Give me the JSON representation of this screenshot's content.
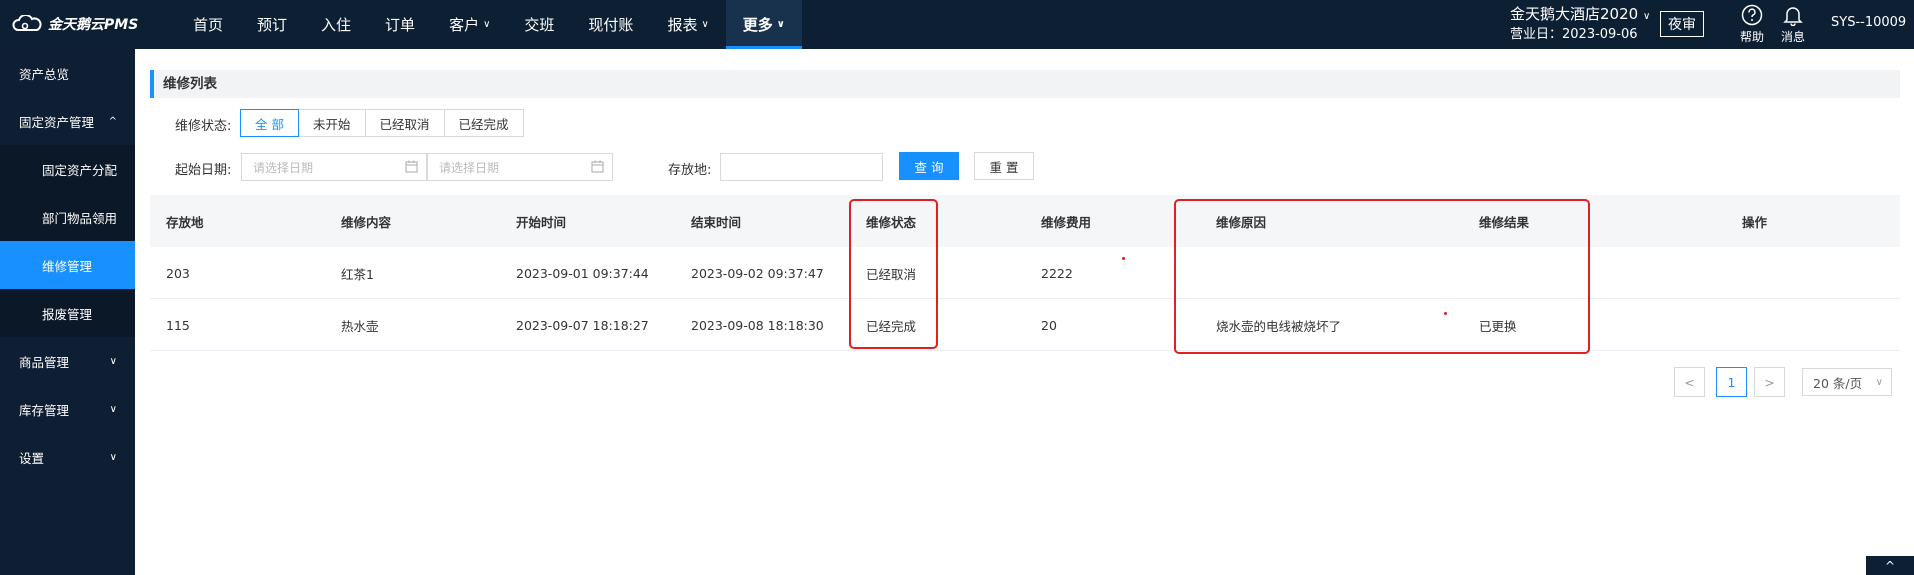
{
  "app": {
    "logo_text": "金天鹅云PMS"
  },
  "nav": {
    "items": [
      {
        "label": "首页"
      },
      {
        "label": "预订"
      },
      {
        "label": "入住"
      },
      {
        "label": "订单"
      },
      {
        "label": "客户",
        "has_dropdown": true
      },
      {
        "label": "交班"
      },
      {
        "label": "现付账"
      },
      {
        "label": "报表",
        "has_dropdown": true
      },
      {
        "label": "更多",
        "has_dropdown": true,
        "active": true
      }
    ],
    "chevron": "∨"
  },
  "header": {
    "hotel_name": "金天鹅大酒店2020",
    "hotel_chevron": "∨",
    "business_date": "营业日：2023-09-06",
    "night_audit": "夜审",
    "help_label": "帮助",
    "message_label": "消息",
    "user": "SYS--10009",
    "user_chevron": "∨"
  },
  "sidebar": {
    "items": [
      {
        "label": "资产总览"
      },
      {
        "label": "固定资产管理",
        "expanded": true,
        "arrow": "^"
      },
      {
        "label": "固定资产分配",
        "sub": true
      },
      {
        "label": "部门物品领用",
        "sub": true
      },
      {
        "label": "维修管理",
        "sub": true,
        "active": true
      },
      {
        "label": "报废管理",
        "sub": true
      },
      {
        "label": "商品管理",
        "arrow": "∨"
      },
      {
        "label": "库存管理",
        "arrow": "∨"
      },
      {
        "label": "设置",
        "arrow": "∨"
      }
    ]
  },
  "main": {
    "section_title": "维修列表",
    "status_filter": {
      "label": "维修状态:",
      "options": [
        "全 部",
        "未开始",
        "已经取消",
        "已经完成"
      ],
      "selected": 0
    },
    "date_filter": {
      "label": "起始日期:",
      "start_placeholder": "请选择日期",
      "end_placeholder": "请选择日期"
    },
    "location_filter": {
      "label": "存放地:",
      "value": ""
    },
    "query_button": "查 询",
    "reset_button": "重 置",
    "table": {
      "columns": [
        "存放地",
        "维修内容",
        "开始时间",
        "结束时间",
        "维修状态",
        "维修费用",
        "维修原因",
        "维修结果",
        "操作"
      ],
      "rows": [
        [
          "203",
          "红茶1",
          "2023-09-01 09:37:44",
          "2023-09-02 09:37:47",
          "已经取消",
          "2222",
          "",
          "",
          ""
        ],
        [
          "115",
          "热水壶",
          "2023-09-07 18:18:27",
          "2023-09-08 18:18:30",
          "已经完成",
          "20",
          "烧水壶的电线被烧坏了",
          "已更换",
          ""
        ]
      ]
    },
    "pagination": {
      "prev": "<",
      "current_page": "1",
      "next": ">",
      "page_size": "20 条/页",
      "size_chevron": "∨"
    }
  },
  "colors": {
    "topbar": "#0d1f33",
    "accent": "#1890ff",
    "annotation": "#e02020"
  },
  "back_to_top": "^"
}
